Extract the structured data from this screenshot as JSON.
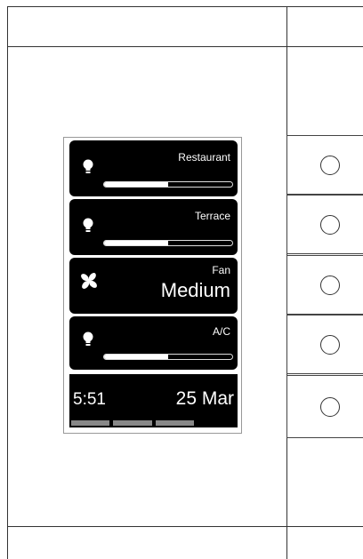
{
  "tiles": [
    {
      "type": "light",
      "label": "Restaurant",
      "level": 0.5
    },
    {
      "type": "light",
      "label": "Terrace",
      "level": 0.5
    },
    {
      "type": "fan",
      "label": "Fan",
      "value": "Medium"
    },
    {
      "type": "light",
      "label": "A/C",
      "level": 0.5
    }
  ],
  "footer": {
    "time": "5:51",
    "date": "25 Mar",
    "active_page": 4,
    "page_count": 4
  }
}
